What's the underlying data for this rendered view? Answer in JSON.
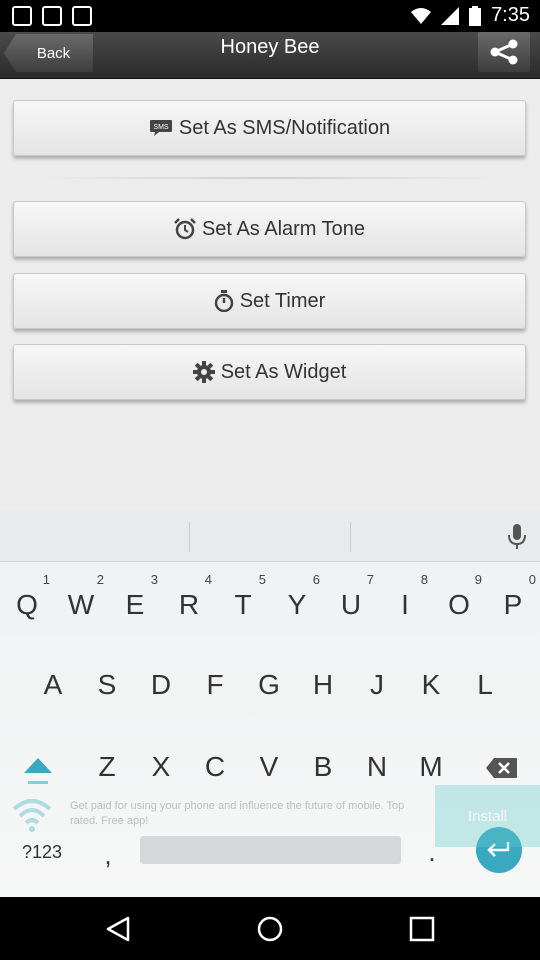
{
  "status": {
    "time": "7:35"
  },
  "appbar": {
    "back_label": "Back",
    "title": "Honey Bee",
    "share_icon": "share-icon"
  },
  "actions": [
    {
      "label": "Set As SMS/Notification",
      "icon": "sms-icon"
    },
    {
      "label": "Set As Alarm Tone",
      "icon": "alarm-clock-icon"
    },
    {
      "label": "Set Timer",
      "icon": "stopwatch-icon"
    },
    {
      "label": "Set As Widget",
      "icon": "gear-icon"
    }
  ],
  "keyboard": {
    "row1": [
      {
        "k": "Q",
        "h": "1"
      },
      {
        "k": "W",
        "h": "2"
      },
      {
        "k": "E",
        "h": "3"
      },
      {
        "k": "R",
        "h": "4"
      },
      {
        "k": "T",
        "h": "5"
      },
      {
        "k": "Y",
        "h": "6"
      },
      {
        "k": "U",
        "h": "7"
      },
      {
        "k": "I",
        "h": "8"
      },
      {
        "k": "O",
        "h": "9"
      },
      {
        "k": "P",
        "h": "0"
      }
    ],
    "row2": [
      "A",
      "S",
      "D",
      "F",
      "G",
      "H",
      "J",
      "K",
      "L"
    ],
    "row3": [
      "Z",
      "X",
      "C",
      "V",
      "B",
      "N",
      "M"
    ],
    "symbols_label": "?123",
    "comma": ",",
    "period": ".",
    "accent_color": "#3aa9c0"
  },
  "ad": {
    "text": "Get paid for using your phone and influence the future of mobile. Top rated. Free app!",
    "install_label": "Install"
  }
}
